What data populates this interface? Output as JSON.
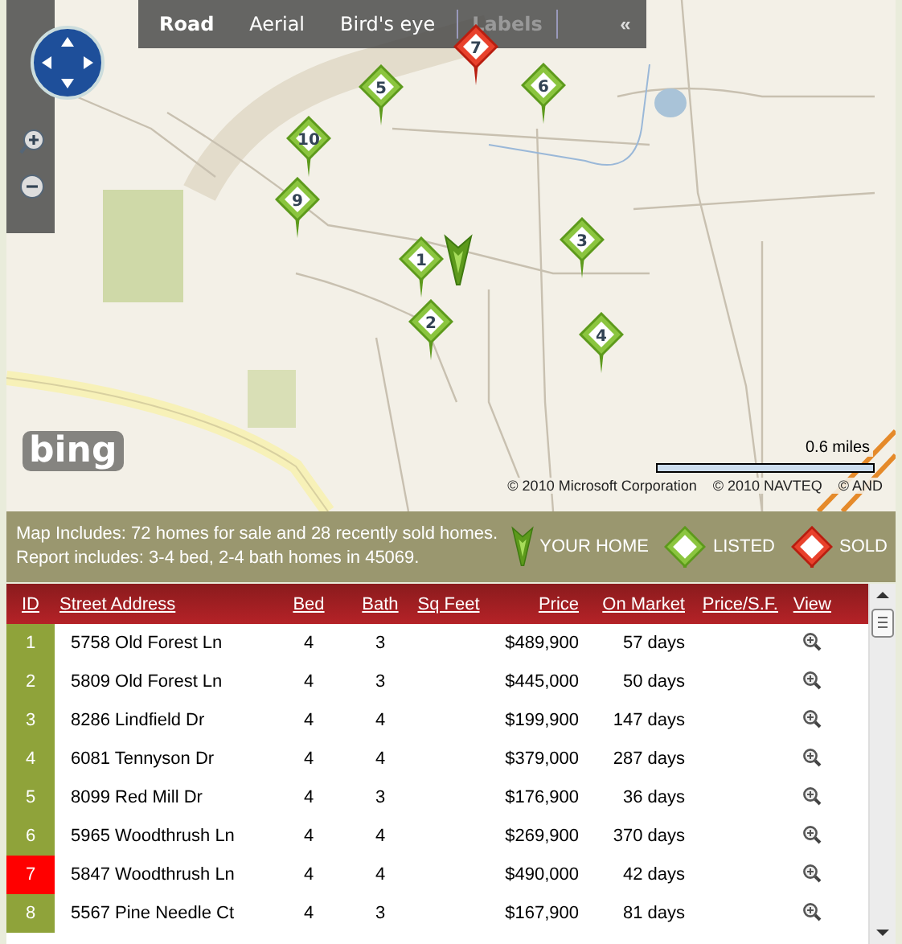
{
  "map": {
    "view_tabs": [
      {
        "label": "Road",
        "selected": true,
        "disabled": false
      },
      {
        "label": "Aerial",
        "selected": false,
        "disabled": false
      },
      {
        "label": "Bird's eye",
        "selected": false,
        "disabled": false
      },
      {
        "label": "Labels",
        "selected": false,
        "disabled": true
      }
    ],
    "collapse": "«",
    "logo": "bing",
    "scale": "0.6 miles",
    "credits": [
      "© 2010 Microsoft Corporation",
      "© 2010 NAVTEQ",
      "© AND"
    ],
    "markers": [
      {
        "label": "1",
        "kind": "listed"
      },
      {
        "label": "2",
        "kind": "listed"
      },
      {
        "label": "3",
        "kind": "listed"
      },
      {
        "label": "4",
        "kind": "listed"
      },
      {
        "label": "5",
        "kind": "listed"
      },
      {
        "label": "6",
        "kind": "listed"
      },
      {
        "label": "7",
        "kind": "sold"
      },
      {
        "label": "9",
        "kind": "listed"
      },
      {
        "label": "10",
        "kind": "listed"
      },
      {
        "kind": "home"
      }
    ]
  },
  "summary": [
    "Map Includes: 72 homes for sale and 28 recently sold homes.",
    "Report includes: 3-4 bed, 2-4 bath homes in 45069."
  ],
  "legend": [
    {
      "kind": "home",
      "label": "YOUR HOME"
    },
    {
      "kind": "listed",
      "label": "LISTED"
    },
    {
      "kind": "sold",
      "label": "SOLD"
    }
  ],
  "table": {
    "columns": [
      "ID",
      "Street Address",
      "Bed",
      "Bath",
      "Sq Feet",
      "Price",
      "On Market",
      "Price/S.F.",
      "View"
    ],
    "rows": [
      {
        "id": "1",
        "address": "5758 Old Forest Ln",
        "bed": "4",
        "bath": "3",
        "price": "$489,900",
        "on_market": "57 days",
        "kind": "listed"
      },
      {
        "id": "2",
        "address": "5809 Old Forest Ln",
        "bed": "4",
        "bath": "3",
        "price": "$445,000",
        "on_market": "50 days",
        "kind": "listed"
      },
      {
        "id": "3",
        "address": "8286 Lindfield Dr",
        "bed": "4",
        "bath": "4",
        "price": "$199,900",
        "on_market": "147 days",
        "kind": "listed"
      },
      {
        "id": "4",
        "address": "6081 Tennyson Dr",
        "bed": "4",
        "bath": "4",
        "price": "$379,000",
        "on_market": "287 days",
        "kind": "listed"
      },
      {
        "id": "5",
        "address": "8099 Red Mill Dr",
        "bed": "4",
        "bath": "3",
        "price": "$176,900",
        "on_market": "36 days",
        "kind": "listed"
      },
      {
        "id": "6",
        "address": "5965 Woodthrush Ln",
        "bed": "4",
        "bath": "4",
        "price": "$269,900",
        "on_market": "370 days",
        "kind": "listed"
      },
      {
        "id": "7",
        "address": "5847 Woodthrush Ln",
        "bed": "4",
        "bath": "4",
        "price": "$490,000",
        "on_market": "42 days",
        "kind": "sold"
      },
      {
        "id": "8",
        "address": "5567 Pine Needle Ct",
        "bed": "4",
        "bath": "3",
        "price": "$167,900",
        "on_market": "81 days",
        "kind": "listed"
      }
    ]
  }
}
